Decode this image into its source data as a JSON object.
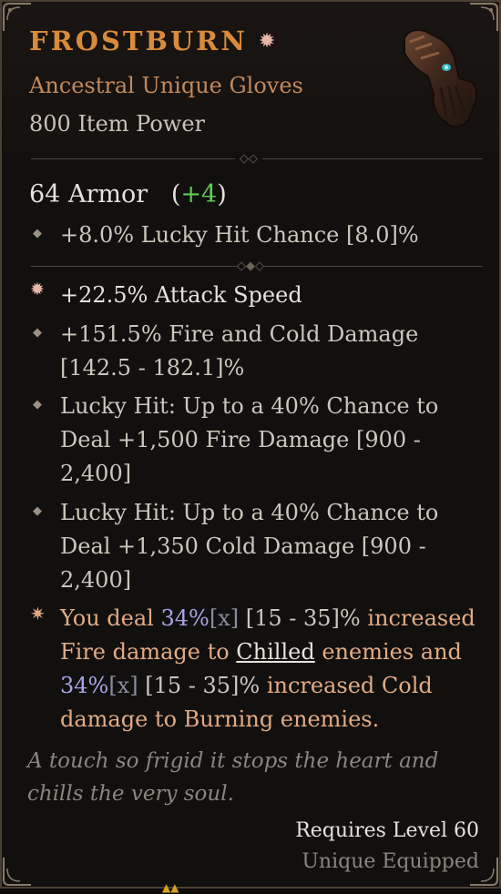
{
  "item": {
    "name": "FROSTBURN",
    "type": "Ancestral Unique Gloves",
    "power": "800 Item Power",
    "armor_value": "64 Armor",
    "armor_bonus": "+4",
    "implicit": "+8.0% Lucky Hit Chance [8.0]%",
    "affixes": [
      {
        "text": "+22.5% Attack Speed",
        "icon": "star-gem-icon"
      },
      {
        "text": "+151.5% Fire and Cold Damage [142.5 - 182.1]%",
        "line1": "+151.5% Fire and Cold Damage",
        "line2": "[142.5 - 182.1]%",
        "icon": "diamond-bullet-icon"
      },
      {
        "line1": "Lucky Hit: Up to a 40% Chance to",
        "line2": "Deal +1,500 Fire Damage [900 -",
        "line3": "2,400]",
        "icon": "diamond-bullet-icon"
      },
      {
        "line1": "Lucky Hit: Up to a 40% Chance to",
        "line2": "Deal +1,350 Cold Damage [900 -",
        "line3": "2,400]",
        "icon": "diamond-bullet-icon"
      }
    ],
    "unique_power": {
      "p1": "You deal ",
      "v1": "34%",
      "x1": "[x]",
      "r1": " [15 - 35]%",
      "p2": " increased",
      "p3": "Fire damage to ",
      "chilled": "Chilled",
      "p4": " enemies and",
      "v2": "34%",
      "x2": "[x]",
      "r2": " [15 - 35]%",
      "p5": " increased Cold",
      "p6": "damage to Burning enemies."
    },
    "flavor": "A touch so frigid it stops the heart and chills the very soul.",
    "requires": "Requires Level 60",
    "equipped": "Unique Equipped"
  },
  "colors": {
    "title": "#d98b3a",
    "unique_text": "#e3aa83",
    "bonus_green": "#5fcf4f",
    "value_purple": "#a7a4e6"
  }
}
